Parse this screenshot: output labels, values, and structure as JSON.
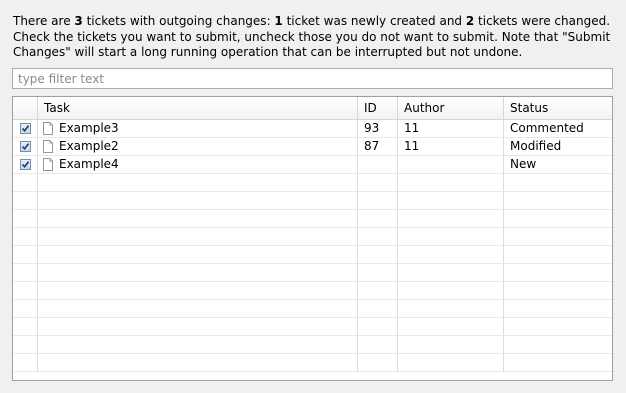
{
  "intro": {
    "p1": "There are ",
    "n1": "3",
    "p2": " tickets with outgoing changes: ",
    "n2": "1",
    "p3": " ticket was newly created and ",
    "n3": "2",
    "p4": " tickets were changed. Check the tickets you want to submit, uncheck those you do not want to submit. Note that \"Submit Changes\" will start a long running operation that can be interrupted but not undone."
  },
  "filter": {
    "placeholder": "type filter text",
    "value": ""
  },
  "table": {
    "headers": {
      "select": "",
      "task": "Task",
      "id": "ID",
      "author": "Author",
      "status": "Status"
    },
    "rows": [
      {
        "checked": true,
        "icon": "document-icon",
        "task": "Example3",
        "id": "93",
        "author": "11",
        "status": "Commented"
      },
      {
        "checked": true,
        "icon": "document-icon",
        "task": "Example2",
        "id": "87",
        "author": "11",
        "status": "Modified"
      },
      {
        "checked": true,
        "icon": "document-icon",
        "task": "Example4",
        "id": "",
        "author": "",
        "status": "New"
      }
    ]
  }
}
